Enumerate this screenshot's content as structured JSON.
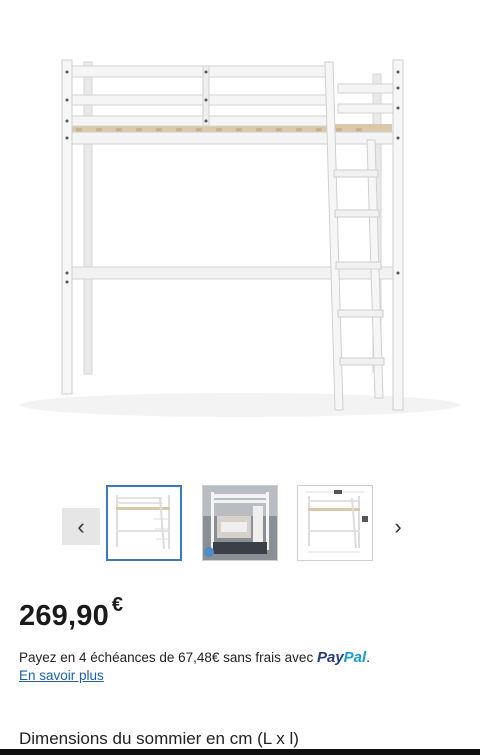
{
  "product_image": {
    "alt_icon": "loft-bed-image"
  },
  "gallery": {
    "prev_icon": "chevron-left-icon",
    "next_icon": "chevron-right-icon",
    "prev_glyph": "‹",
    "next_glyph": "›",
    "thumbnails": [
      {
        "name": "thumbnail-1",
        "active": true
      },
      {
        "name": "thumbnail-2",
        "active": false
      },
      {
        "name": "thumbnail-3",
        "active": false
      }
    ]
  },
  "price": {
    "amount": "269,90",
    "currency": "€"
  },
  "payment": {
    "text": "Payez en 4 échéances de 67,48€ sans frais avec",
    "paypal_part1": "Pay",
    "paypal_part2": "Pal",
    "suffix": ".",
    "learn_more": "En savoir plus"
  },
  "specs": {
    "dimensions_heading": "Dimensions du sommier en cm (L x l)"
  },
  "colors": {
    "accent": "#3b78c4",
    "link": "#1a5fb4",
    "paypal_dark": "#253b80",
    "paypal_light": "#179bd7"
  }
}
